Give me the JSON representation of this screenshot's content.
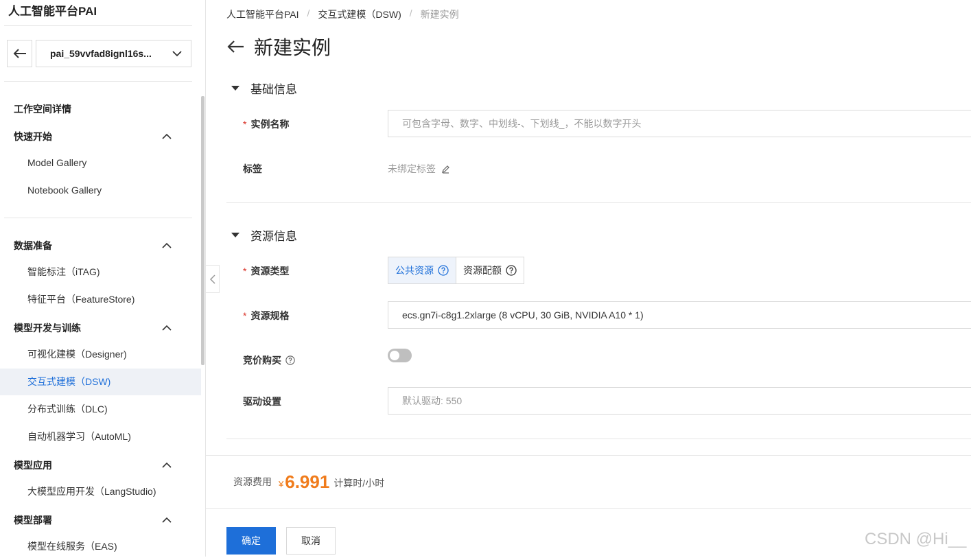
{
  "sidebar": {
    "brand": "人工智能平台PAI",
    "workspace": "pai_59vvfad8ignl16s...",
    "workspace_detail": "工作空间详情",
    "groups": [
      {
        "title": "快速开始",
        "items": [
          "Model Gallery",
          "Notebook Gallery"
        ]
      },
      {
        "title": "数据准备",
        "items": [
          "智能标注（iTAG)",
          "特征平台（FeatureStore)"
        ]
      },
      {
        "title": "模型开发与训练",
        "items": [
          "可视化建模（Designer)",
          "交互式建模（DSW)",
          "分布式训练（DLC)",
          "自动机器学习（AutoML)"
        ]
      },
      {
        "title": "模型应用",
        "items": [
          "大模型应用开发（LangStudio)"
        ]
      },
      {
        "title": "模型部署",
        "items": [
          "模型在线服务（EAS)"
        ]
      }
    ],
    "active_item": "交互式建模（DSW)"
  },
  "breadcrumb": [
    "人工智能平台PAI",
    "交互式建模（DSW)",
    "新建实例"
  ],
  "page_title": "新建实例",
  "basic_section": {
    "title": "基础信息",
    "name_label": "实例名称",
    "name_placeholder": "可包含字母、数字、中划线-、下划线_，不能以数字开头",
    "tags_label": "标签",
    "tags_value": "未绑定标签"
  },
  "resource_section": {
    "title": "资源信息",
    "type_label": "资源类型",
    "type_options": [
      "公共资源",
      "资源配额"
    ],
    "type_selected": "公共资源",
    "spec_label": "资源规格",
    "spec_value": "ecs.gn7i-c8g1.2xlarge  (8 vCPU, 30 GiB, NVIDIA A10 * 1)",
    "spot_label": "竞价购买",
    "spot_enabled": false,
    "driver_label": "驱动设置",
    "driver_placeholder": "默认驱动: 550"
  },
  "cost": {
    "label": "资源费用",
    "currency": "¥",
    "value": "6.991",
    "unit": "计算时/小时"
  },
  "actions": {
    "confirm": "确定",
    "cancel": "取消"
  },
  "watermark": "CSDN @Hi__",
  "colors": {
    "primary": "#1e6fd9",
    "price": "#f07c1c",
    "required": "#d93026"
  }
}
